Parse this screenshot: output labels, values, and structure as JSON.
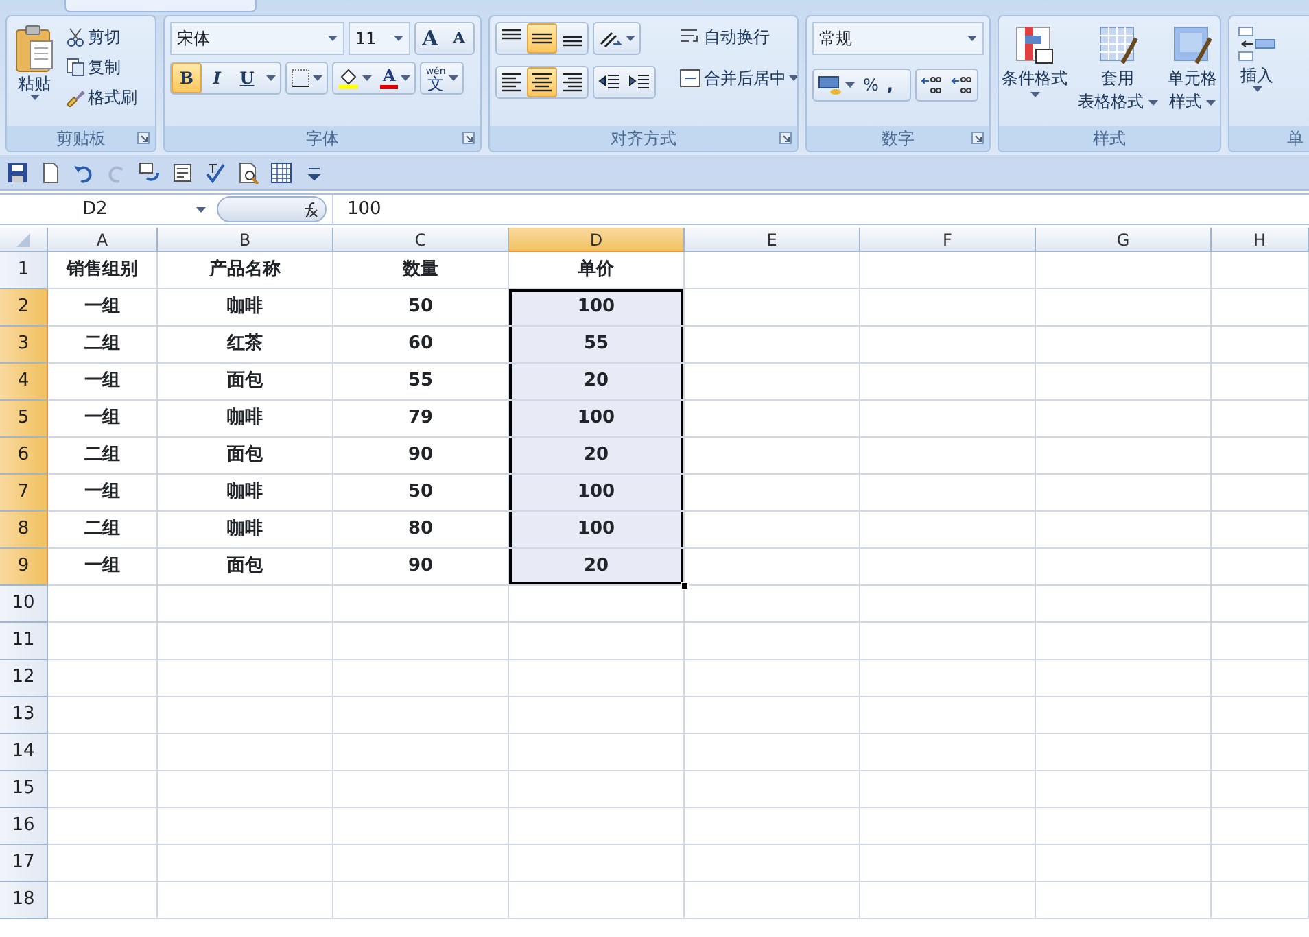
{
  "ribbon": {
    "groups": [
      {
        "kind": "clipboard",
        "label": "剪贴板",
        "paste": "粘贴",
        "actions": [
          "剪切",
          "复制",
          "格式刷"
        ]
      },
      {
        "kind": "font",
        "label": "字体",
        "font_name": "宋体",
        "font_size": "11",
        "size_buttons": [
          "A",
          "A"
        ],
        "style_buttons": [
          {
            "kind": "bold",
            "label": "B",
            "selected": true
          },
          {
            "kind": "italic",
            "label": "I",
            "selected": false
          },
          {
            "kind": "underline",
            "label": "U",
            "selected": false
          }
        ],
        "font_color": "A",
        "phonetic": {
          "ruby": "wén",
          "base": "文"
        }
      },
      {
        "kind": "alignment",
        "label": "对齐方式",
        "vertical": [
          {
            "kind": "top",
            "selected": false
          },
          {
            "kind": "middle",
            "selected": true
          },
          {
            "kind": "bottom",
            "selected": false
          }
        ],
        "horizontal": [
          {
            "kind": "left",
            "selected": false
          },
          {
            "kind": "center",
            "selected": true
          },
          {
            "kind": "right",
            "selected": false
          }
        ],
        "wrap": "自动换行",
        "merge": "合并后居中"
      },
      {
        "kind": "number",
        "label": "数字",
        "format": "常规",
        "percent": "%",
        "comma": ","
      },
      {
        "kind": "styles",
        "label": "样式",
        "buttons": [
          {
            "kind": "conditional",
            "lines": [
              "条件格式"
            ]
          },
          {
            "kind": "table",
            "lines": [
              "套用",
              "表格格式"
            ]
          },
          {
            "kind": "cell",
            "lines": [
              "单元格",
              "样式"
            ]
          }
        ]
      },
      {
        "kind": "cells",
        "label": "单",
        "buttons": [
          "插入"
        ]
      }
    ]
  },
  "name_box": "D2",
  "formula": "100",
  "columns": [
    {
      "label": "A",
      "selected": false
    },
    {
      "label": "B",
      "selected": false
    },
    {
      "label": "C",
      "selected": false
    },
    {
      "label": "D",
      "selected": true
    },
    {
      "label": "E",
      "selected": false
    },
    {
      "label": "F",
      "selected": false
    },
    {
      "label": "G",
      "selected": false
    },
    {
      "label": "H",
      "selected": false
    }
  ],
  "rows": [
    {
      "number": "1",
      "selected": false,
      "cells": [
        {
          "text": "销售组别",
          "selected": false
        },
        {
          "text": "产品名称",
          "selected": false
        },
        {
          "text": "数量",
          "selected": false
        },
        {
          "text": "单价",
          "selected": false
        }
      ]
    },
    {
      "number": "2",
      "selected": true,
      "cells": [
        {
          "text": "一组",
          "selected": false
        },
        {
          "text": "咖啡",
          "selected": false
        },
        {
          "text": "50",
          "selected": false
        },
        {
          "text": "100",
          "selected": true
        }
      ]
    },
    {
      "number": "3",
      "selected": true,
      "cells": [
        {
          "text": "二组",
          "selected": false
        },
        {
          "text": "红茶",
          "selected": false
        },
        {
          "text": "60",
          "selected": false
        },
        {
          "text": "55",
          "selected": true
        }
      ]
    },
    {
      "number": "4",
      "selected": true,
      "cells": [
        {
          "text": "一组",
          "selected": false
        },
        {
          "text": "面包",
          "selected": false
        },
        {
          "text": "55",
          "selected": false
        },
        {
          "text": "20",
          "selected": true
        }
      ]
    },
    {
      "number": "5",
      "selected": true,
      "cells": [
        {
          "text": "一组",
          "selected": false
        },
        {
          "text": "咖啡",
          "selected": false
        },
        {
          "text": "79",
          "selected": false
        },
        {
          "text": "100",
          "selected": true
        }
      ]
    },
    {
      "number": "6",
      "selected": true,
      "cells": [
        {
          "text": "二组",
          "selected": false
        },
        {
          "text": "面包",
          "selected": false
        },
        {
          "text": "90",
          "selected": false
        },
        {
          "text": "20",
          "selected": true
        }
      ]
    },
    {
      "number": "7",
      "selected": true,
      "cells": [
        {
          "text": "一组",
          "selected": false
        },
        {
          "text": "咖啡",
          "selected": false
        },
        {
          "text": "50",
          "selected": false
        },
        {
          "text": "100",
          "selected": true
        }
      ]
    },
    {
      "number": "8",
      "selected": true,
      "cells": [
        {
          "text": "二组",
          "selected": false
        },
        {
          "text": "咖啡",
          "selected": false
        },
        {
          "text": "80",
          "selected": false
        },
        {
          "text": "100",
          "selected": true
        }
      ]
    },
    {
      "number": "9",
      "selected": true,
      "cells": [
        {
          "text": "一组",
          "selected": false
        },
        {
          "text": "面包",
          "selected": false
        },
        {
          "text": "90",
          "selected": false
        },
        {
          "text": "20",
          "selected": true
        }
      ]
    },
    {
      "number": "10",
      "selected": false,
      "cells": []
    },
    {
      "number": "11",
      "selected": false,
      "cells": []
    },
    {
      "number": "12",
      "selected": false,
      "cells": []
    },
    {
      "number": "13",
      "selected": false,
      "cells": []
    },
    {
      "number": "14",
      "selected": false,
      "cells": []
    },
    {
      "number": "15",
      "selected": false,
      "cells": []
    },
    {
      "number": "16",
      "selected": false,
      "cells": []
    },
    {
      "number": "17",
      "selected": false,
      "cells": []
    },
    {
      "number": "18",
      "selected": false,
      "cells": []
    }
  ]
}
